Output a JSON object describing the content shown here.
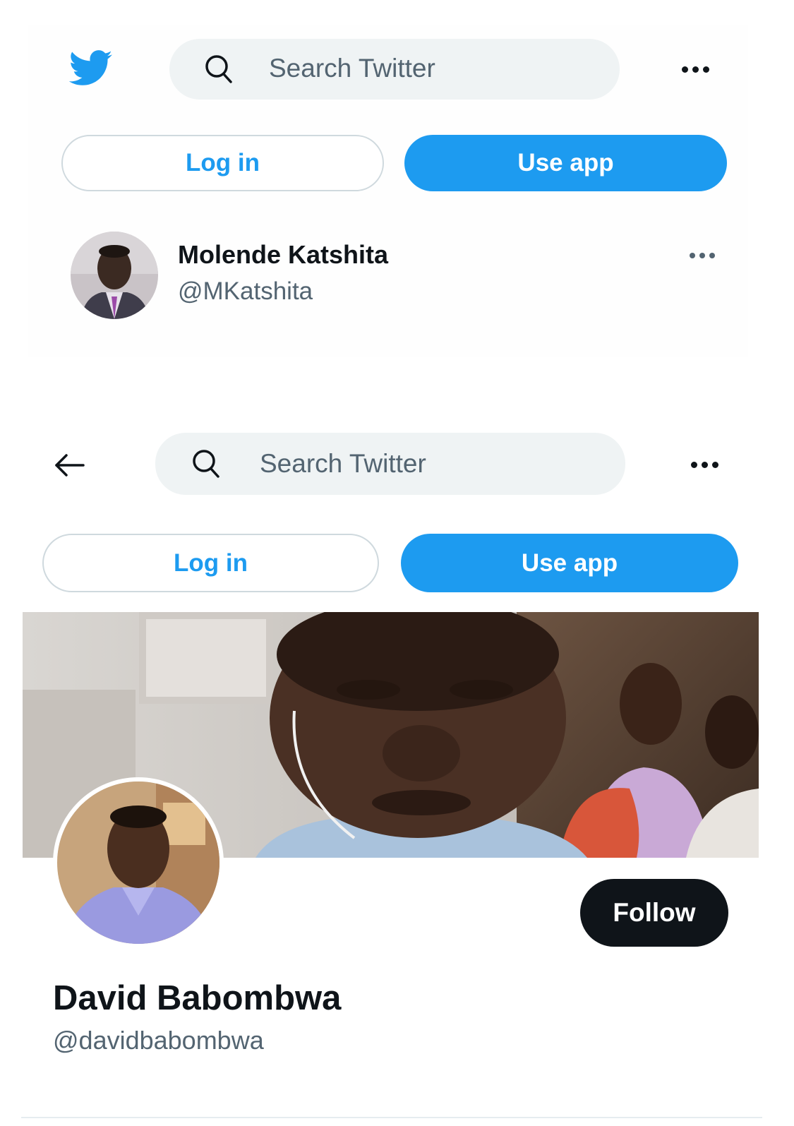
{
  "first_card": {
    "logo_icon": "twitter-bird-icon",
    "search": {
      "placeholder": "Search Twitter",
      "icon": "search-icon"
    },
    "more_icon": "more-dots-icon",
    "login_label": "Log in",
    "use_app_label": "Use app",
    "profile": {
      "name": "Molende Katshita",
      "handle": "@MKatshita"
    }
  },
  "second_card": {
    "back_icon": "back-arrow-icon",
    "search": {
      "placeholder": "Search Twitter",
      "icon": "search-icon"
    },
    "more_icon": "more-dots-icon",
    "login_label": "Log in",
    "use_app_label": "Use app",
    "follow_label": "Follow",
    "profile": {
      "name": "David Babombwa",
      "handle": "@davidbabombwa"
    }
  },
  "colors": {
    "twitter_blue": "#1d9bf0",
    "text_primary": "#0f1419",
    "text_secondary": "#536471",
    "search_bg": "#eff3f4"
  }
}
